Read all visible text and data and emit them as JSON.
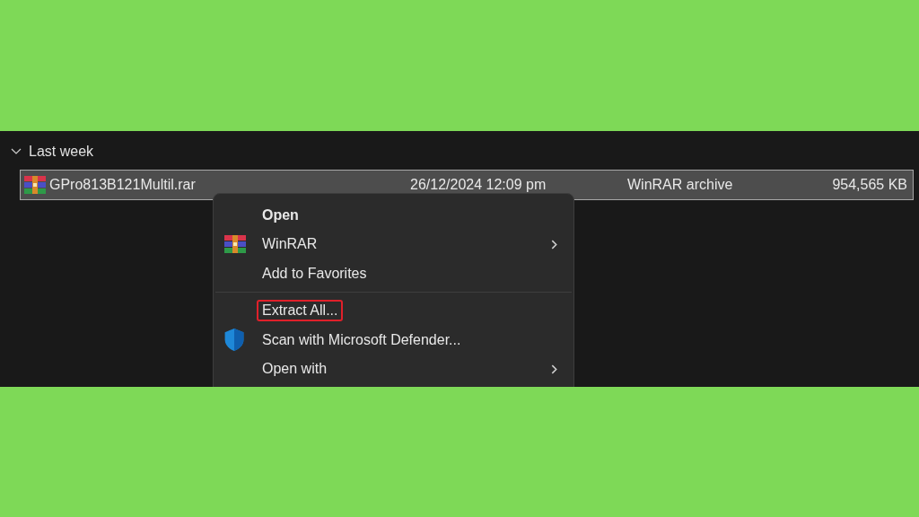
{
  "group": {
    "label": "Last week",
    "expanded": true
  },
  "file": {
    "name": "GPro813B121Multil.rar",
    "date": "26/12/2024 12:09 pm",
    "type": "WinRAR archive",
    "size": "954,565 KB",
    "selected": true
  },
  "context_menu": {
    "items": [
      {
        "kind": "plain",
        "label": "Open",
        "default": true,
        "submenu": false,
        "highlighted": false
      },
      {
        "kind": "archive",
        "label": "WinRAR",
        "default": false,
        "submenu": true,
        "highlighted": false
      },
      {
        "kind": "plain",
        "label": "Add to Favorites",
        "default": false,
        "submenu": false,
        "highlighted": false
      },
      {
        "kind": "divider"
      },
      {
        "kind": "plain",
        "label": "Extract All...",
        "default": false,
        "submenu": false,
        "highlighted": true
      },
      {
        "kind": "shield",
        "label": "Scan with Microsoft Defender...",
        "default": false,
        "submenu": false,
        "highlighted": false
      },
      {
        "kind": "plain",
        "label": "Open with",
        "default": false,
        "submenu": true,
        "highlighted": false
      }
    ]
  }
}
